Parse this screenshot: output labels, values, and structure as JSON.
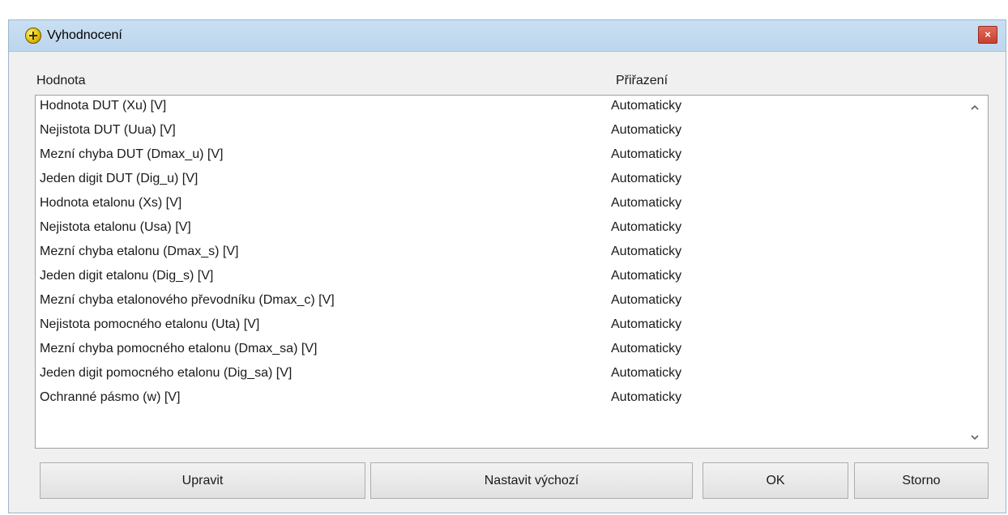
{
  "window": {
    "title": "Vyhodnocení",
    "close_label": "×"
  },
  "columns": {
    "hodnota": "Hodnota",
    "prirazeni": "Přiřazení"
  },
  "rows": [
    {
      "name": "Hodnota DUT (Xu) [V]",
      "assign": "Automaticky"
    },
    {
      "name": "Nejistota DUT (Uua) [V]",
      "assign": "Automaticky"
    },
    {
      "name": "Mezní chyba DUT (Dmax_u) [V]",
      "assign": "Automaticky"
    },
    {
      "name": "Jeden digit DUT (Dig_u) [V]",
      "assign": "Automaticky"
    },
    {
      "name": "Hodnota etalonu (Xs) [V]",
      "assign": "Automaticky"
    },
    {
      "name": "Nejistota etalonu (Usa) [V]",
      "assign": "Automaticky"
    },
    {
      "name": "Mezní chyba etalonu (Dmax_s) [V]",
      "assign": "Automaticky"
    },
    {
      "name": "Jeden digit etalonu (Dig_s) [V]",
      "assign": "Automaticky"
    },
    {
      "name": "Mezní chyba etalonového převodníku (Dmax_c) [V]",
      "assign": "Automaticky"
    },
    {
      "name": "Nejistota pomocného etalonu (Uta) [V]",
      "assign": "Automaticky"
    },
    {
      "name": "Mezní chyba pomocného etalonu (Dmax_sa) [V]",
      "assign": "Automaticky"
    },
    {
      "name": "Jeden digit pomocného etalonu (Dig_sa) [V]",
      "assign": "Automaticky"
    },
    {
      "name": "Ochranné pásmo (w) [V]",
      "assign": "Automaticky"
    }
  ],
  "icons": {
    "app": "plus-circle-icon",
    "scroll_up": "chevron-up-icon",
    "scroll_down": "chevron-down-icon"
  },
  "buttons": {
    "upravit": "Upravit",
    "nastavit_vychozi": "Nastavit výchozí",
    "ok": "OK",
    "storno": "Storno"
  }
}
